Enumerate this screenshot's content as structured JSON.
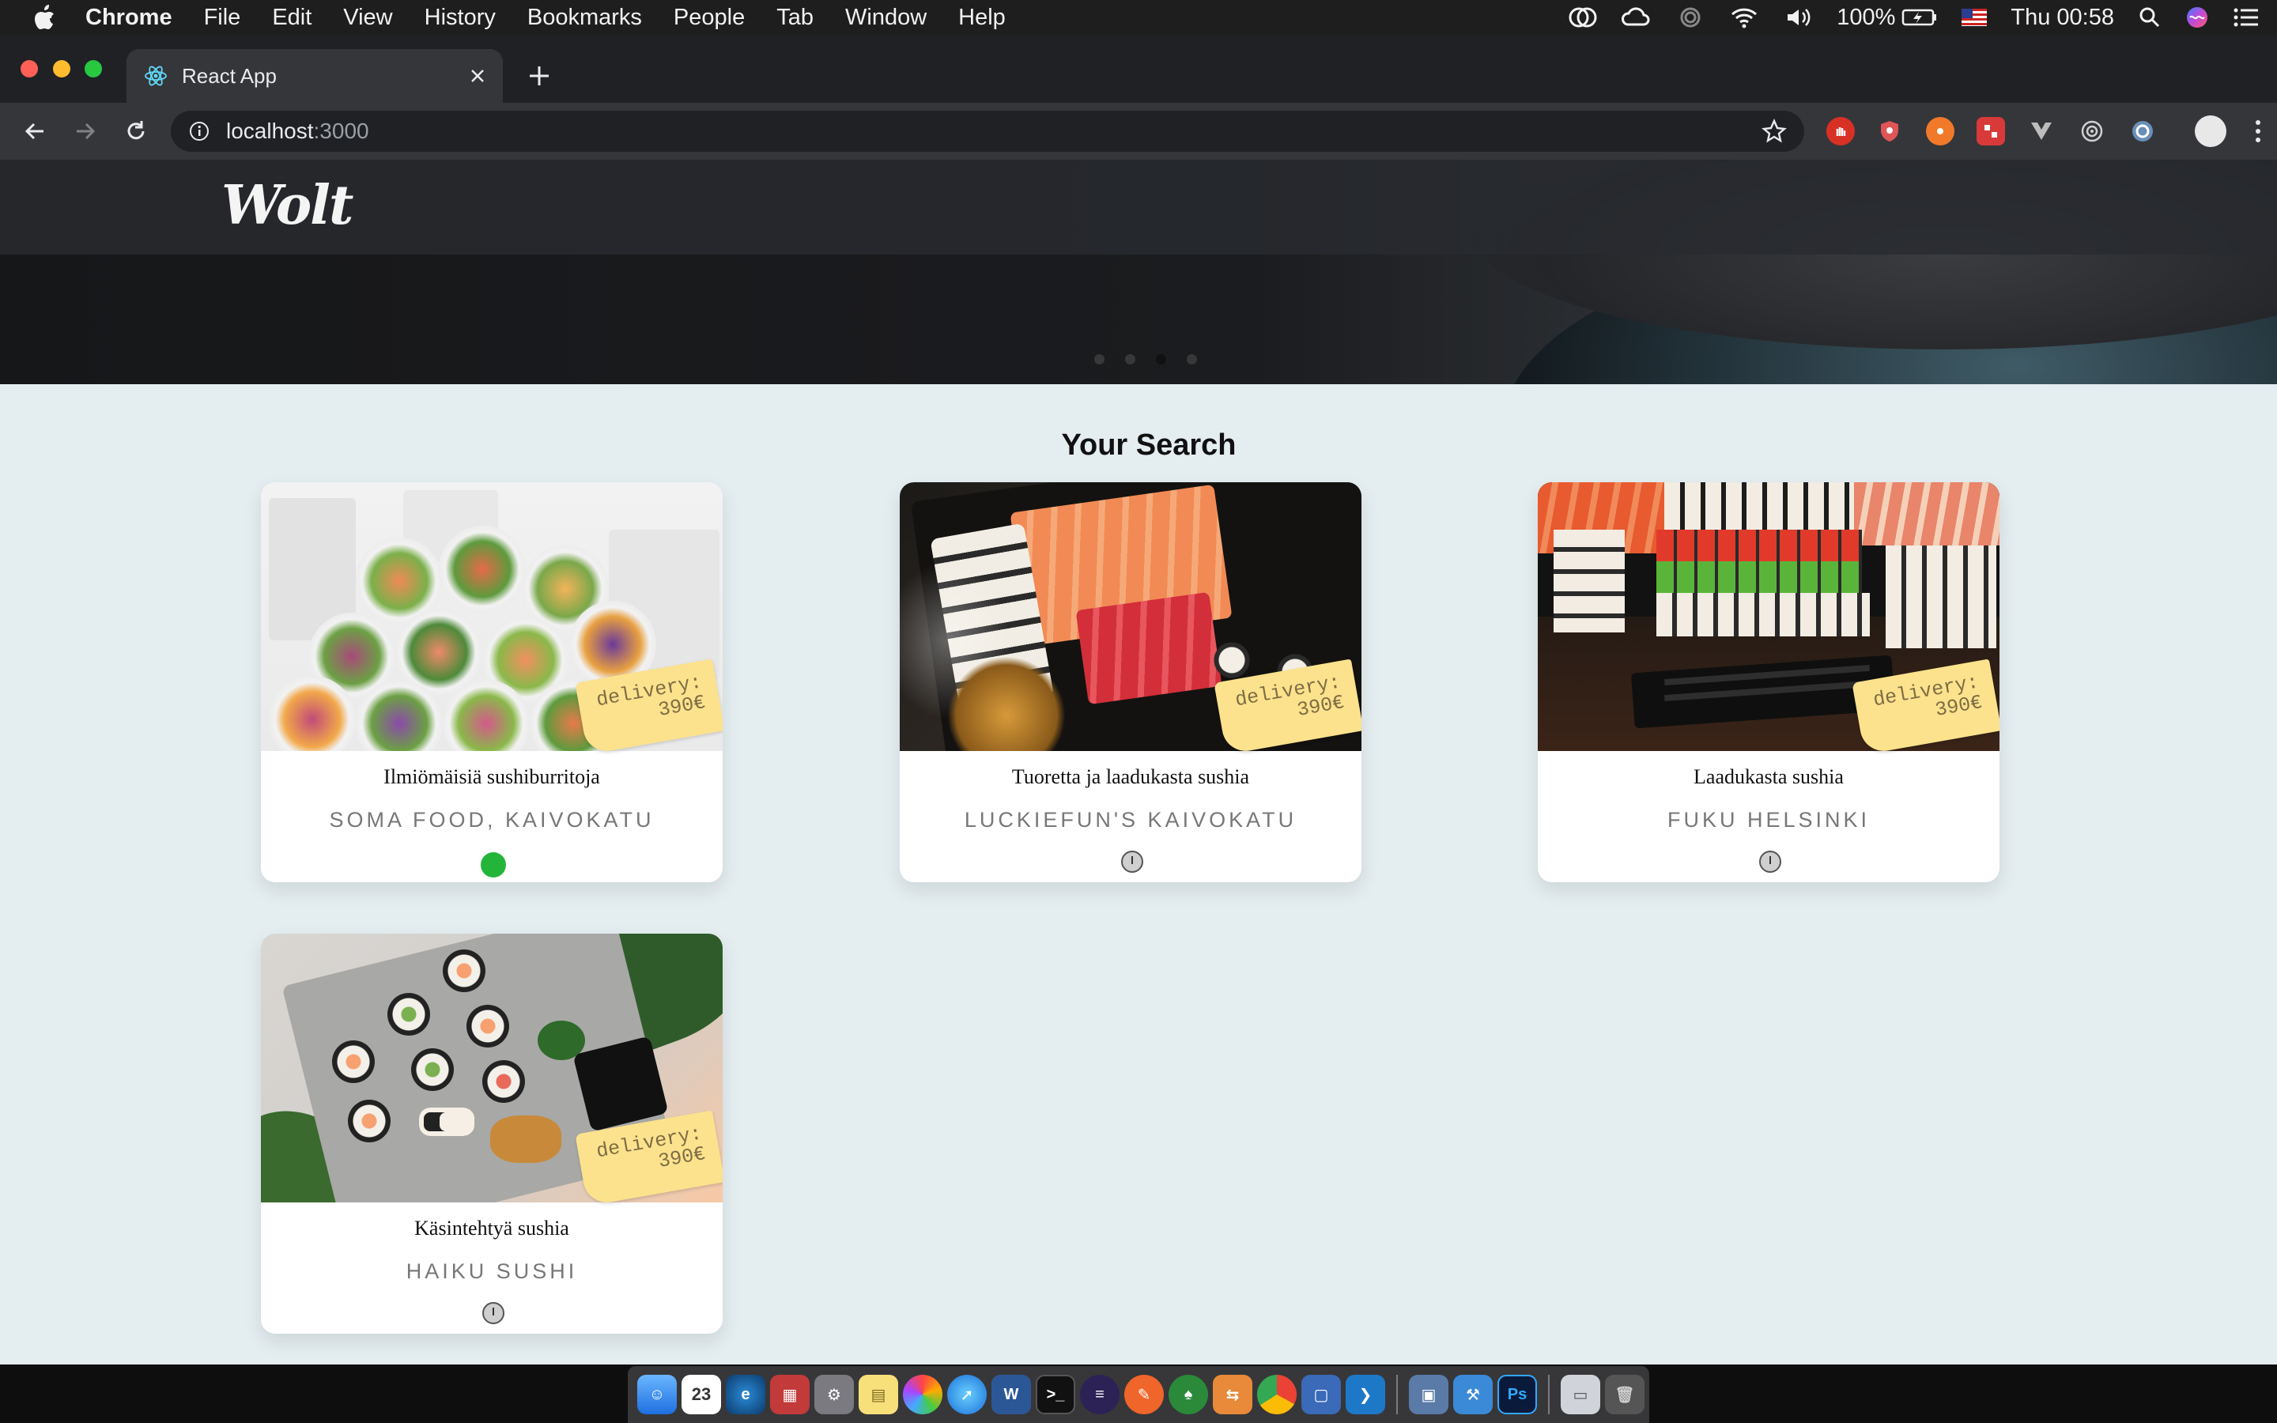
{
  "menubar": {
    "app_name": "Chrome",
    "items": [
      "File",
      "Edit",
      "View",
      "History",
      "Bookmarks",
      "People",
      "Tab",
      "Window",
      "Help"
    ],
    "battery": "100%",
    "clock": "Thu 00:58"
  },
  "browser": {
    "tab_title": "React App",
    "url_host": "localhost",
    "url_port": ":3000"
  },
  "page": {
    "logo": "Wolt",
    "section_title": "Your Search",
    "carousel": {
      "dot_count": 4,
      "active_index": 2
    },
    "cards": [
      {
        "dish": "Ilmiömäisiä sushiburritoja",
        "restaurant": "Soma Food, Kaivokatu",
        "delivery_label": "delivery:",
        "delivery_price": "390€",
        "status": "open"
      },
      {
        "dish": "Tuoretta ja laadukasta sushia",
        "restaurant": "Luckiefun's Kaivokatu",
        "delivery_label": "delivery:",
        "delivery_price": "390€",
        "status": "closed"
      },
      {
        "dish": "Laadukasta sushia",
        "restaurant": "Fuku Helsinki",
        "delivery_label": "delivery:",
        "delivery_price": "390€",
        "status": "closed"
      },
      {
        "dish": "Käsintehtyä sushia",
        "restaurant": "Haiku Sushi",
        "delivery_label": "delivery:",
        "delivery_price": "390€",
        "status": "closed"
      }
    ]
  },
  "colors": {
    "page_bg": "#e4edf0",
    "open_status": "#22b53a",
    "tag_bg": "#fce28d"
  }
}
